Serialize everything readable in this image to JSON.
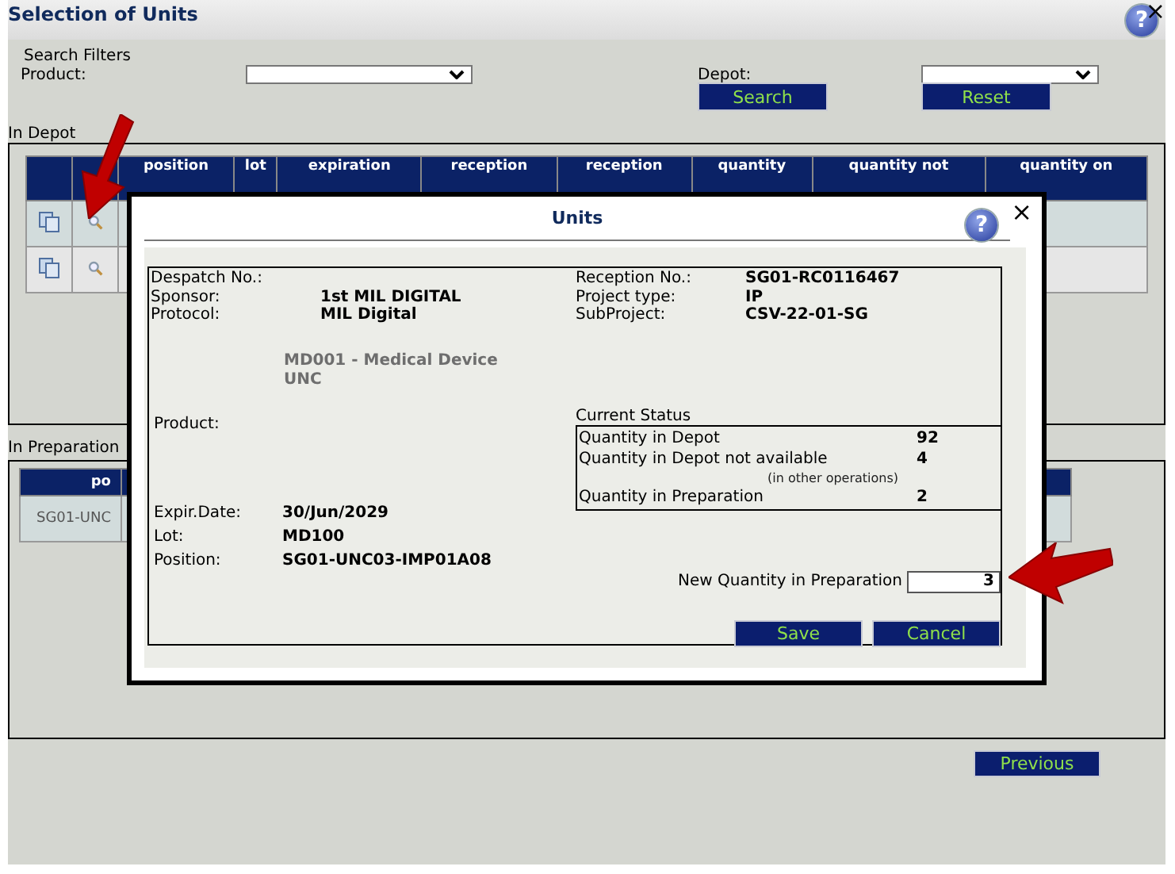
{
  "window": {
    "title": "Selection of Units",
    "help_glyph": "?",
    "close_glyph": "×"
  },
  "search_filters": {
    "title": "Search Filters",
    "fields": [
      {
        "label": "Product:"
      },
      {
        "label": "Depot:"
      }
    ],
    "buttons": [
      "Search",
      "Reset"
    ]
  },
  "in_depot": {
    "title": "In Depot",
    "columns": [
      "position",
      "lot",
      "expiration",
      "reception",
      "reception",
      "quantity",
      "quantity not",
      "quantity on"
    ],
    "rows": [
      {
        "kind": "unit"
      },
      {
        "kind": "unit"
      }
    ]
  },
  "in_preparation": {
    "title": "In Preparation",
    "columns": [
      "po"
    ],
    "rows": [
      [
        "SG01-UNC"
      ]
    ]
  },
  "dialog": {
    "title": "Units",
    "help_glyph": "?",
    "close_glyph": "×",
    "left_fields": [
      {
        "label": "Despatch No.:"
      },
      {
        "label": "Sponsor:",
        "value": "1st MIL DIGITAL"
      },
      {
        "label": "Protocol:",
        "value": "MIL Digital"
      }
    ],
    "right_fields": [
      {
        "label": "Reception No.:",
        "value": "SG01-RC0116467"
      },
      {
        "label": "Project type:",
        "value": "IP"
      },
      {
        "label": "SubProject:",
        "value": "CSV-22-01-SG"
      }
    ],
    "product_name": [
      "MD001 - Medical Device",
      "UNC"
    ],
    "product_label": "Product:",
    "details": [
      {
        "label": "Expir.Date:",
        "value": "30/Jun/2029"
      },
      {
        "label": "Lot:",
        "value": "MD100"
      },
      {
        "label": "Position:",
        "value": "SG01-UNC03-IMP01A08"
      }
    ],
    "current_status": {
      "title": "Current Status",
      "rows": [
        {
          "label": "Quantity in Depot",
          "value": "92"
        },
        {
          "label": "Quantity in Depot not available",
          "value": "4",
          "note": "(in other operations)"
        },
        {
          "label": "Quantity in Preparation",
          "value": "2"
        }
      ]
    },
    "new_quantity": {
      "label": "New Quantity in Preparation",
      "value": "3"
    },
    "buttons": [
      "Save",
      "Cancel"
    ]
  },
  "footer": {
    "buttons": [
      "Previous"
    ]
  }
}
